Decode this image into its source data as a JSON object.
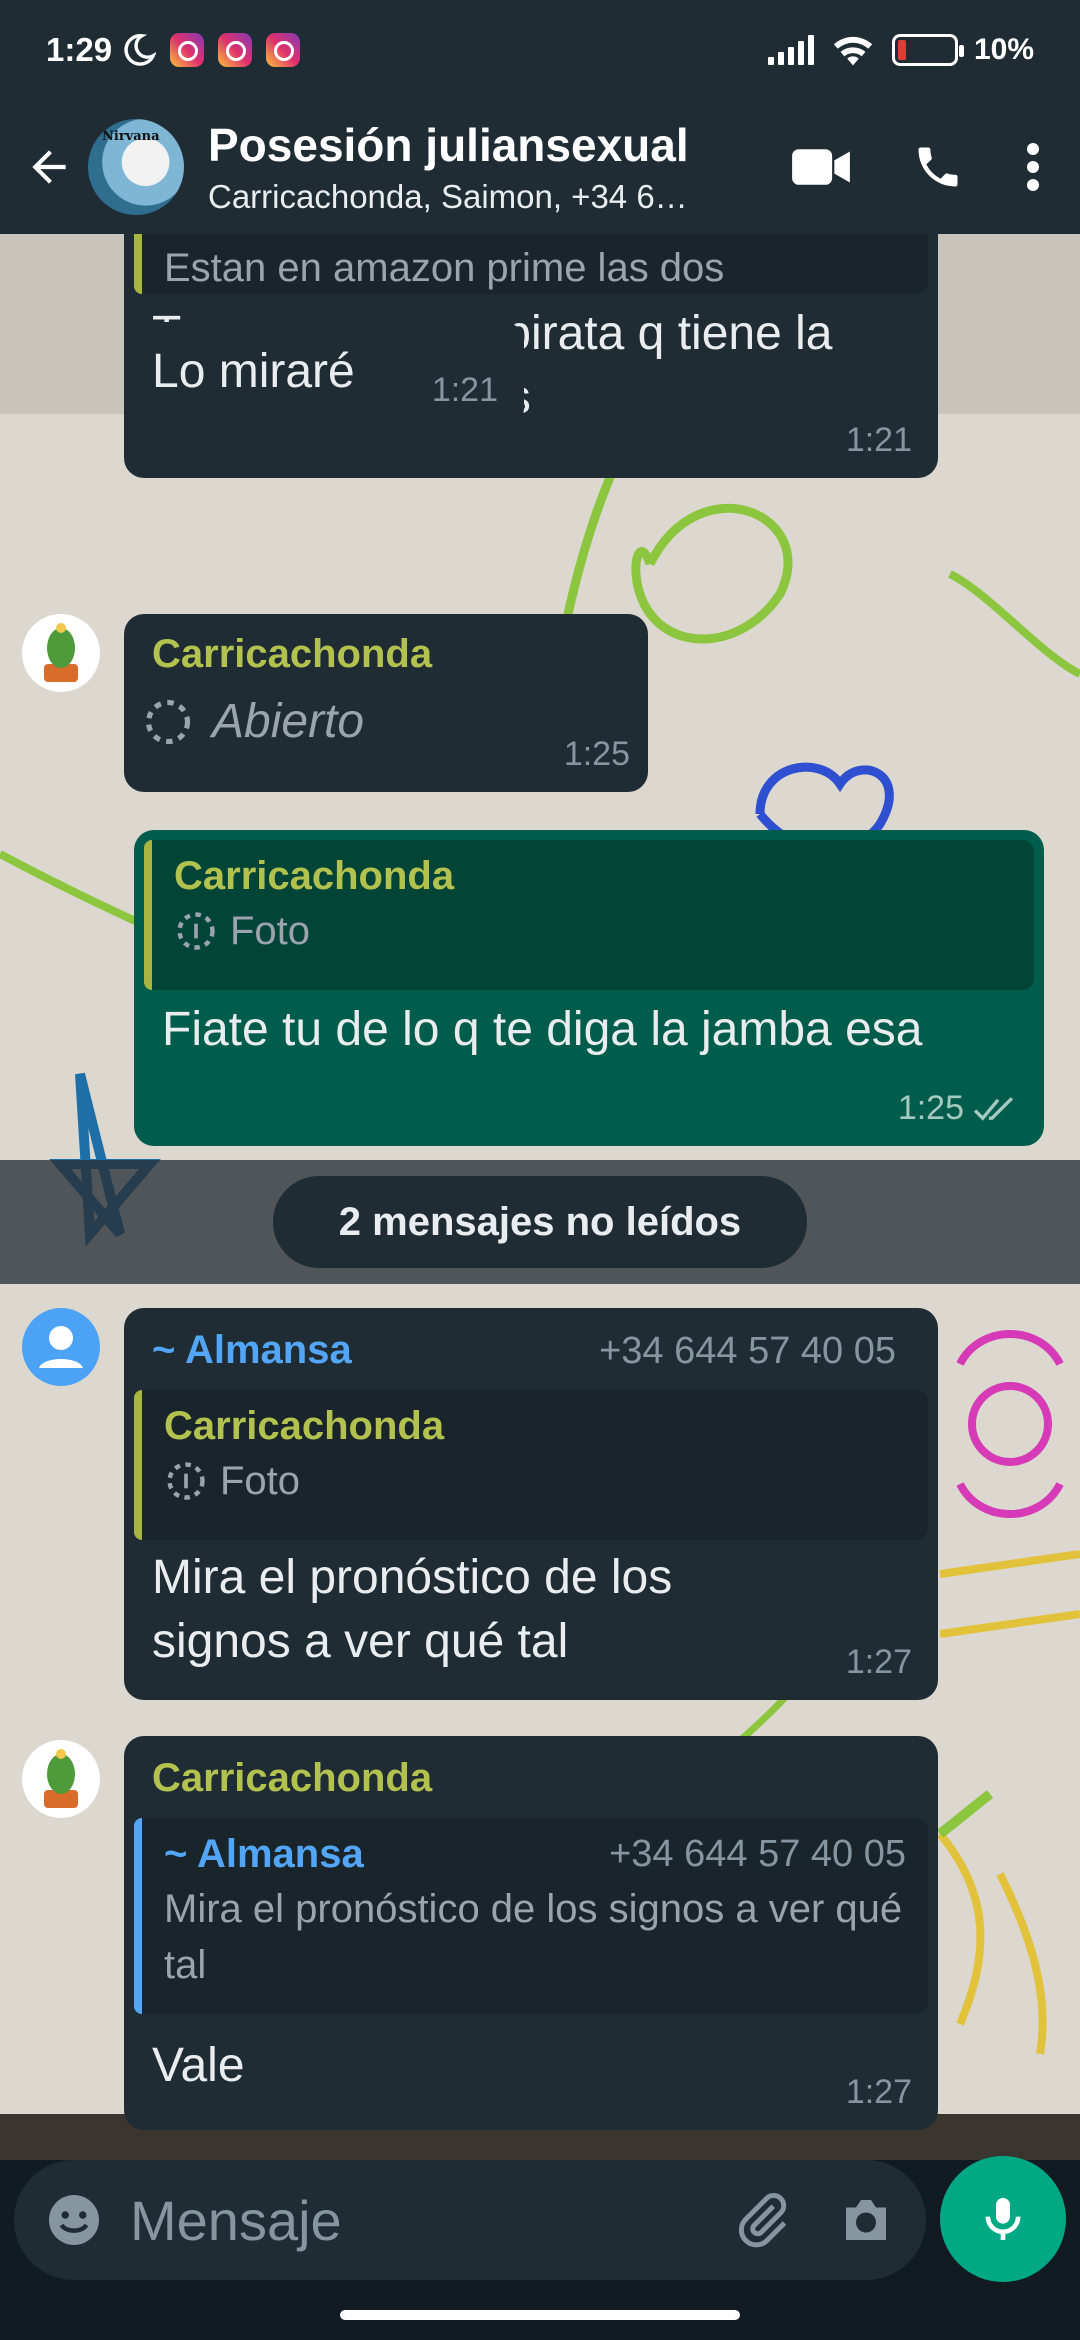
{
  "status_bar": {
    "time": "1:29",
    "battery": "10%"
  },
  "header": {
    "avatar_text": "Nirvana",
    "title": "Posesión juliansexual",
    "subtitle": "Carricachonda, Saimon, +34 6…"
  },
  "messages": {
    "m1": {
      "quote_text": "Estan en amazon prime las dos",
      "text": "Tengo una cosa pirata q tiene la mayoría de cosas",
      "time": "1:21"
    },
    "m2": {
      "text": "Lo miraré",
      "time": "1:21"
    },
    "m3": {
      "sender": "Carricachonda",
      "text": "Abierto",
      "time": "1:25"
    },
    "m4": {
      "quote_sender": "Carricachonda",
      "quote_text": "Foto",
      "text": "Fiate tu de lo q te diga la jamba esa",
      "time": "1:25"
    },
    "unread": "2 mensajes no leídos",
    "m5": {
      "sender": "~ Almansa",
      "phone": "+34 644 57 40 05",
      "quote_sender": "Carricachonda",
      "quote_text": "Foto",
      "text": "Mira el pronóstico de los signos a ver qué tal",
      "time": "1:27"
    },
    "m6": {
      "sender": "Carricachonda",
      "quote_sender": "~ Almansa",
      "quote_phone": "+34 644 57 40 05",
      "quote_text": "Mira el pronóstico de los signos a ver qué tal",
      "text": "Vale",
      "time": "1:27"
    }
  },
  "composer": {
    "placeholder": "Mensaje"
  },
  "colors": {
    "accent": "#00a884",
    "outgoing": "#005c4b",
    "incoming": "#1f2c34",
    "sender_green": "#b3c24e",
    "sender_blue": "#53a5f7"
  }
}
